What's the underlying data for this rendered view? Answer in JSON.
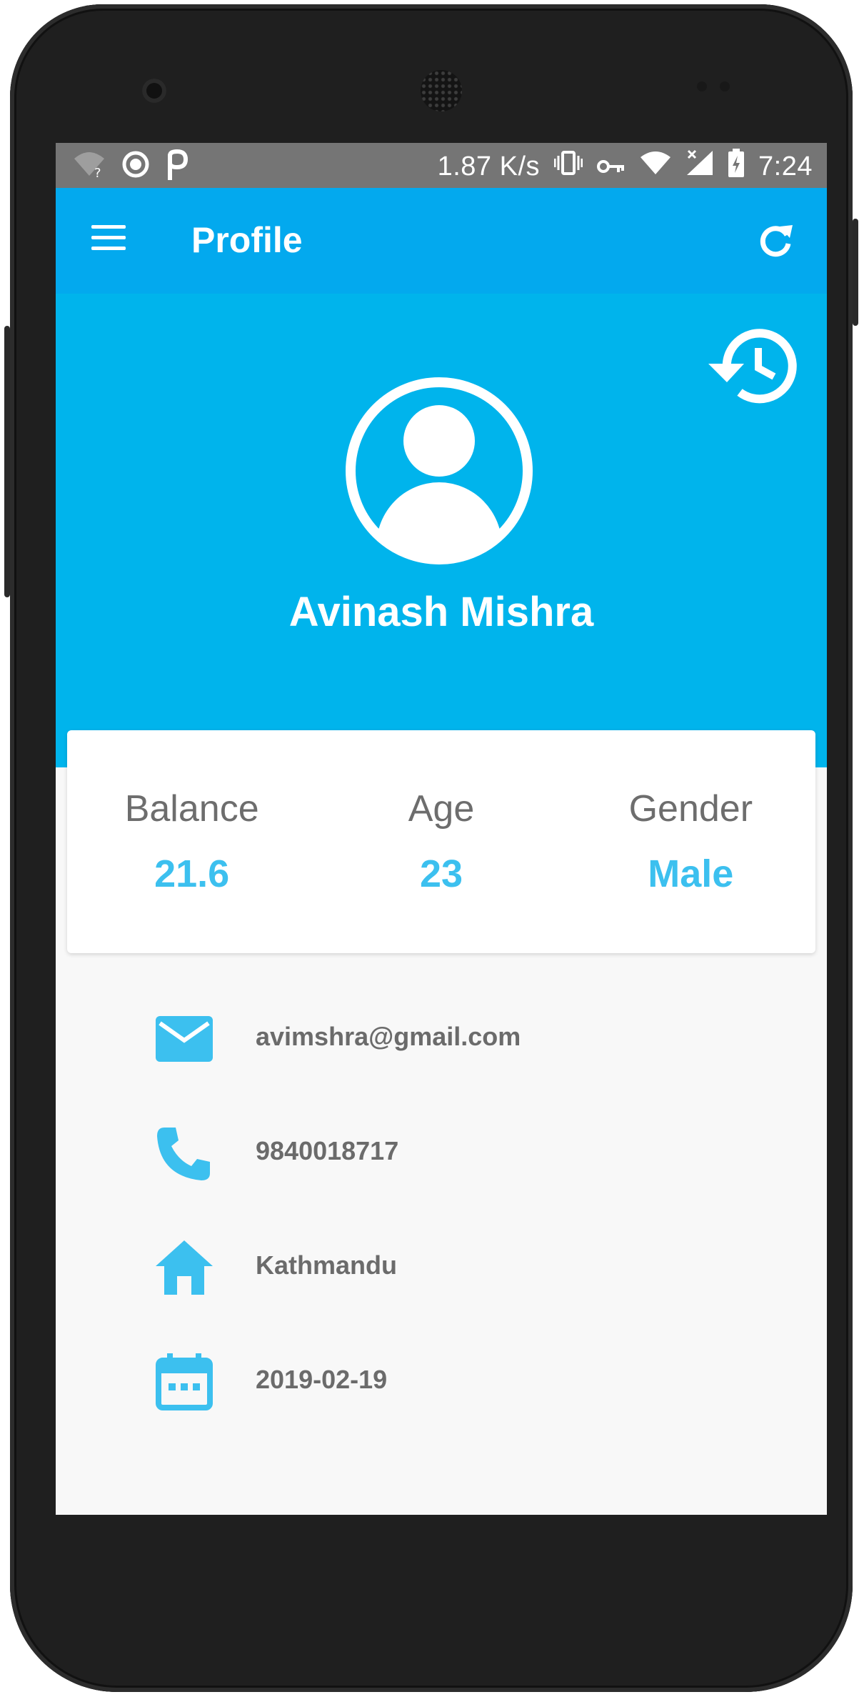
{
  "status_bar": {
    "network_speed": "1.87 K/s",
    "time": "7:24"
  },
  "app_bar": {
    "title": "Profile",
    "icons": [
      "menu-icon",
      "refresh-icon"
    ]
  },
  "profile": {
    "name": "Avinash Mishra",
    "icons": [
      "history-icon",
      "avatar-icon"
    ]
  },
  "stats": [
    {
      "label": "Balance",
      "value": "21.6"
    },
    {
      "label": "Age",
      "value": "23"
    },
    {
      "label": "Gender",
      "value": "Male"
    }
  ],
  "details": [
    {
      "icon": "email-icon",
      "text": "avimshra@gmail.com"
    },
    {
      "icon": "phone-icon",
      "text": "9840018717"
    },
    {
      "icon": "home-icon",
      "text": "Kathmandu"
    },
    {
      "icon": "calendar-icon",
      "text": "2019-02-19"
    }
  ],
  "colors": {
    "app_bar": "#03a9ee",
    "header": "#00b4ec",
    "accent": "#3cc0ef",
    "status_bar": "#757575"
  }
}
